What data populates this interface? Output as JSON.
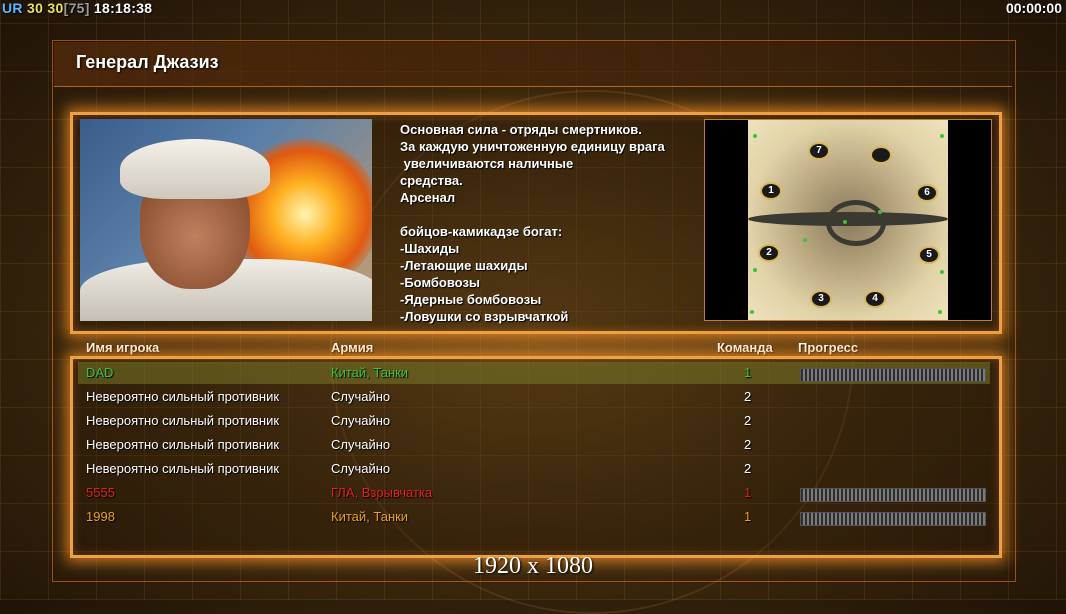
{
  "status": {
    "ur_label": "UR",
    "fps": "30",
    "fps2": "30",
    "bracket_value": "[75]",
    "clock": "18:18:38",
    "game_timer": "00:00:00"
  },
  "window": {
    "title": "Генерал Джазиз"
  },
  "general": {
    "description_lines": [
      "Основная сила - отряды смертников.",
      "За каждую уничтоженную единицу врага",
      " увеличиваются наличные",
      "средства.",
      "Арсенал",
      "",
      "бойцов-камикадзе богат:",
      "-Шахиды",
      "-Летающие шахиды",
      "-Бомбовозы",
      "-Ядерные бомбовозы",
      "-Ловушки со взрывчаткой"
    ]
  },
  "map": {
    "spawns": [
      "7",
      "1",
      "6",
      "2",
      "5",
      "3",
      "4"
    ]
  },
  "table": {
    "headers": {
      "name": "Имя игрока",
      "army": "Армия",
      "team": "Команда",
      "progress": "Прогресс"
    },
    "rows": [
      {
        "name": "DAD",
        "army": "Китай, Танки",
        "team": "1",
        "color": "#3fbf3f",
        "progress": 1.0
      },
      {
        "name": "Невероятно сильный противник",
        "army": "Случайно",
        "team": "2",
        "color": "#ffffff"
      },
      {
        "name": "Невероятно сильный противник",
        "army": "Случайно",
        "team": "2",
        "color": "#ffffff"
      },
      {
        "name": "Невероятно сильный противник",
        "army": "Случайно",
        "team": "2",
        "color": "#ffffff"
      },
      {
        "name": "Невероятно сильный противник",
        "army": "Случайно",
        "team": "2",
        "color": "#ffffff"
      },
      {
        "name": "5555",
        "army": "ГЛА, Взрывчатка",
        "team": "1",
        "color": "#e02020",
        "progress": 1.0
      },
      {
        "name": "1998",
        "army": "Китай, Танки",
        "team": "1",
        "color": "#e8a020",
        "progress": 1.0
      }
    ]
  },
  "overlay": {
    "resolution": "1920 x 1080"
  },
  "colors": {
    "accent": "#f0a040",
    "selected_row": "#78782a"
  }
}
